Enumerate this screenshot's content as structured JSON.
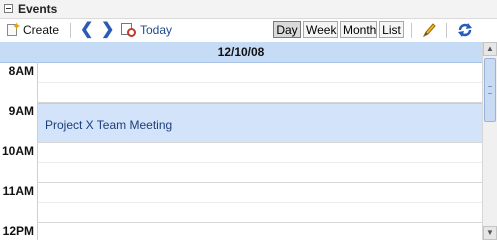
{
  "panel": {
    "title": "Events"
  },
  "toolbar": {
    "create_label": "Create",
    "today_label": "Today",
    "views": [
      "Day",
      "Week",
      "Month",
      "List"
    ],
    "active_view": "Day"
  },
  "calendar": {
    "date": "12/10/08",
    "hours": [
      "8AM",
      "9AM",
      "10AM",
      "11AM",
      "12PM"
    ],
    "events": [
      {
        "title": "Project X Team Meeting",
        "start": "9AM",
        "end": "10AM"
      }
    ]
  },
  "colors": {
    "date_bar": "#c6dcf6",
    "event_bg": "#d3e3fa",
    "event_text": "#1d3f7a"
  }
}
